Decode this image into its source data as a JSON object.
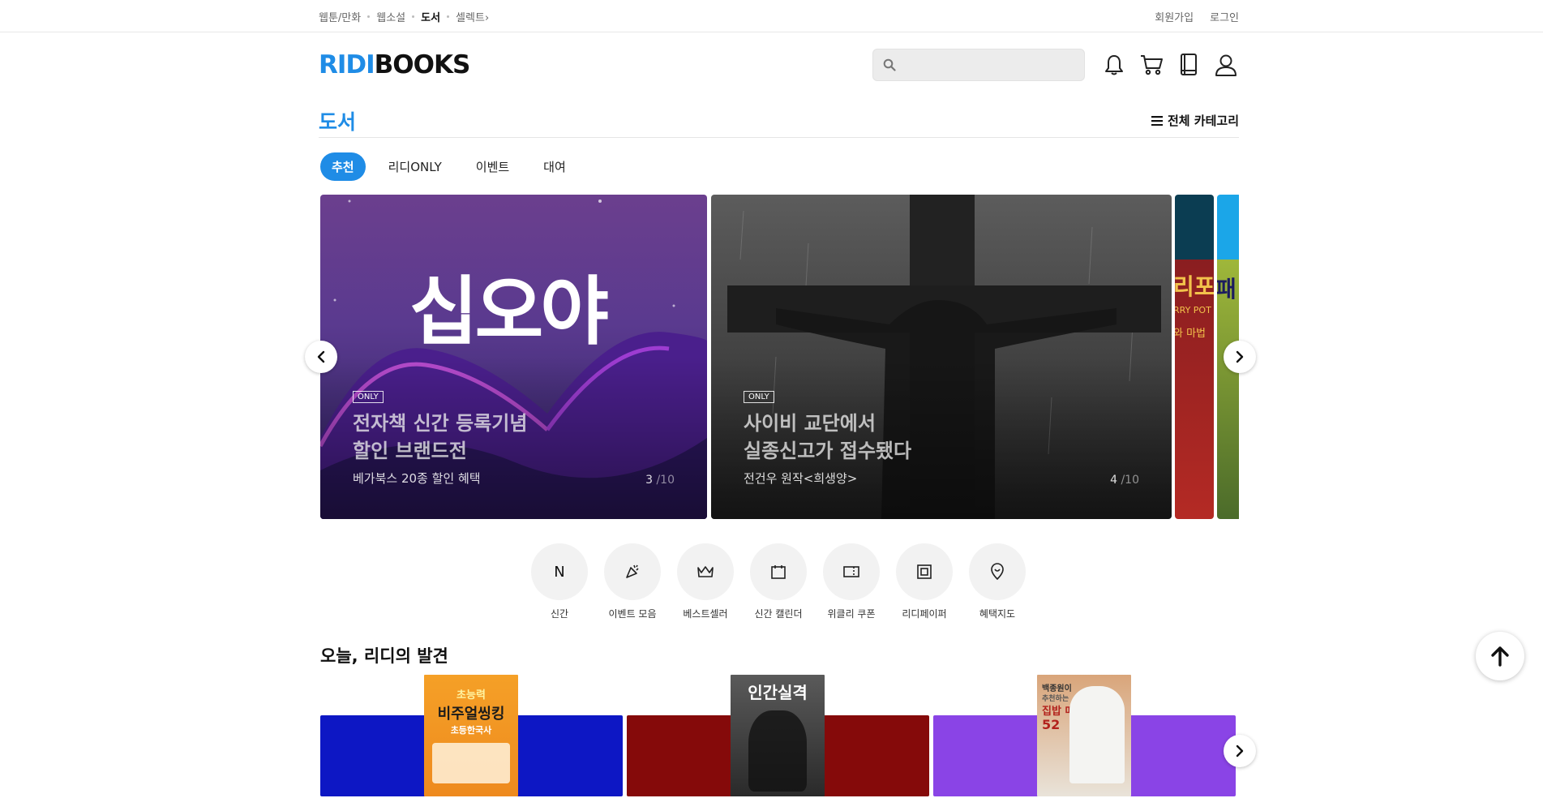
{
  "topnav": {
    "items": [
      "웹툰/만화",
      "웹소설",
      "도서",
      "셀렉트"
    ],
    "active_index": 2,
    "select_suffix": "›"
  },
  "toplinks": {
    "signup": "회원가입",
    "login": "로그인"
  },
  "logo": {
    "ridi": "RIDI",
    "books": "BOOKS"
  },
  "search": {
    "placeholder": ""
  },
  "header_icons": [
    "bell-icon",
    "cart-icon",
    "library-icon",
    "profile-icon"
  ],
  "section": {
    "title": "도서",
    "all_categories": "전체 카테고리"
  },
  "tabs": [
    "추천",
    "리디ONLY",
    "이벤트",
    "대여"
  ],
  "banners": [
    {
      "badge": "ONLY",
      "title_line1": "전자책 신간 등록기념",
      "title_line2": "할인 브랜드전",
      "subtitle": "베가북스 20종 할인 혜택",
      "index": "3",
      "total": "/10",
      "art_text": "십오야"
    },
    {
      "badge": "ONLY",
      "title_line1": "사이비 교단에서",
      "title_line2": "실종신고가 접수됐다",
      "subtitle": "전건우 원작<희생양>",
      "index": "4",
      "total": "/10"
    }
  ],
  "partial_banner_texts": {
    "b3_top": "리포",
    "b3_mid": "RRY POT",
    "b3_low": "와 마법",
    "b4_top": "패"
  },
  "quick_menu": [
    {
      "label": "신간",
      "icon": "new-icon",
      "glyph": "N"
    },
    {
      "label": "이벤트 모음",
      "icon": "party-popper-icon"
    },
    {
      "label": "베스트셀러",
      "icon": "crown-icon"
    },
    {
      "label": "신간 캘린더",
      "icon": "calendar-icon"
    },
    {
      "label": "위클리 쿠폰",
      "icon": "coupon-icon"
    },
    {
      "label": "리디페이퍼",
      "icon": "ereader-icon"
    },
    {
      "label": "혜택지도",
      "icon": "map-pin-icon"
    }
  ],
  "discover": {
    "title": "오늘, 리디의 발견",
    "books": [
      {
        "cover_line1": "초능력",
        "cover_line2": "비주얼씽킹",
        "cover_line3": "초등한국사",
        "color": "#0d17c4"
      },
      {
        "cover_line1": "인간실격",
        "color": "#850a0a"
      },
      {
        "cover_line1": "백종원이",
        "cover_line2": "추천하는",
        "cover_line3": "집밥 메뉴",
        "cover_line4": "52",
        "color": "#8a44e6"
      }
    ]
  },
  "colors": {
    "brand_blue": "#1f8ce6",
    "tab_active_bg": "#1f8ce6"
  }
}
